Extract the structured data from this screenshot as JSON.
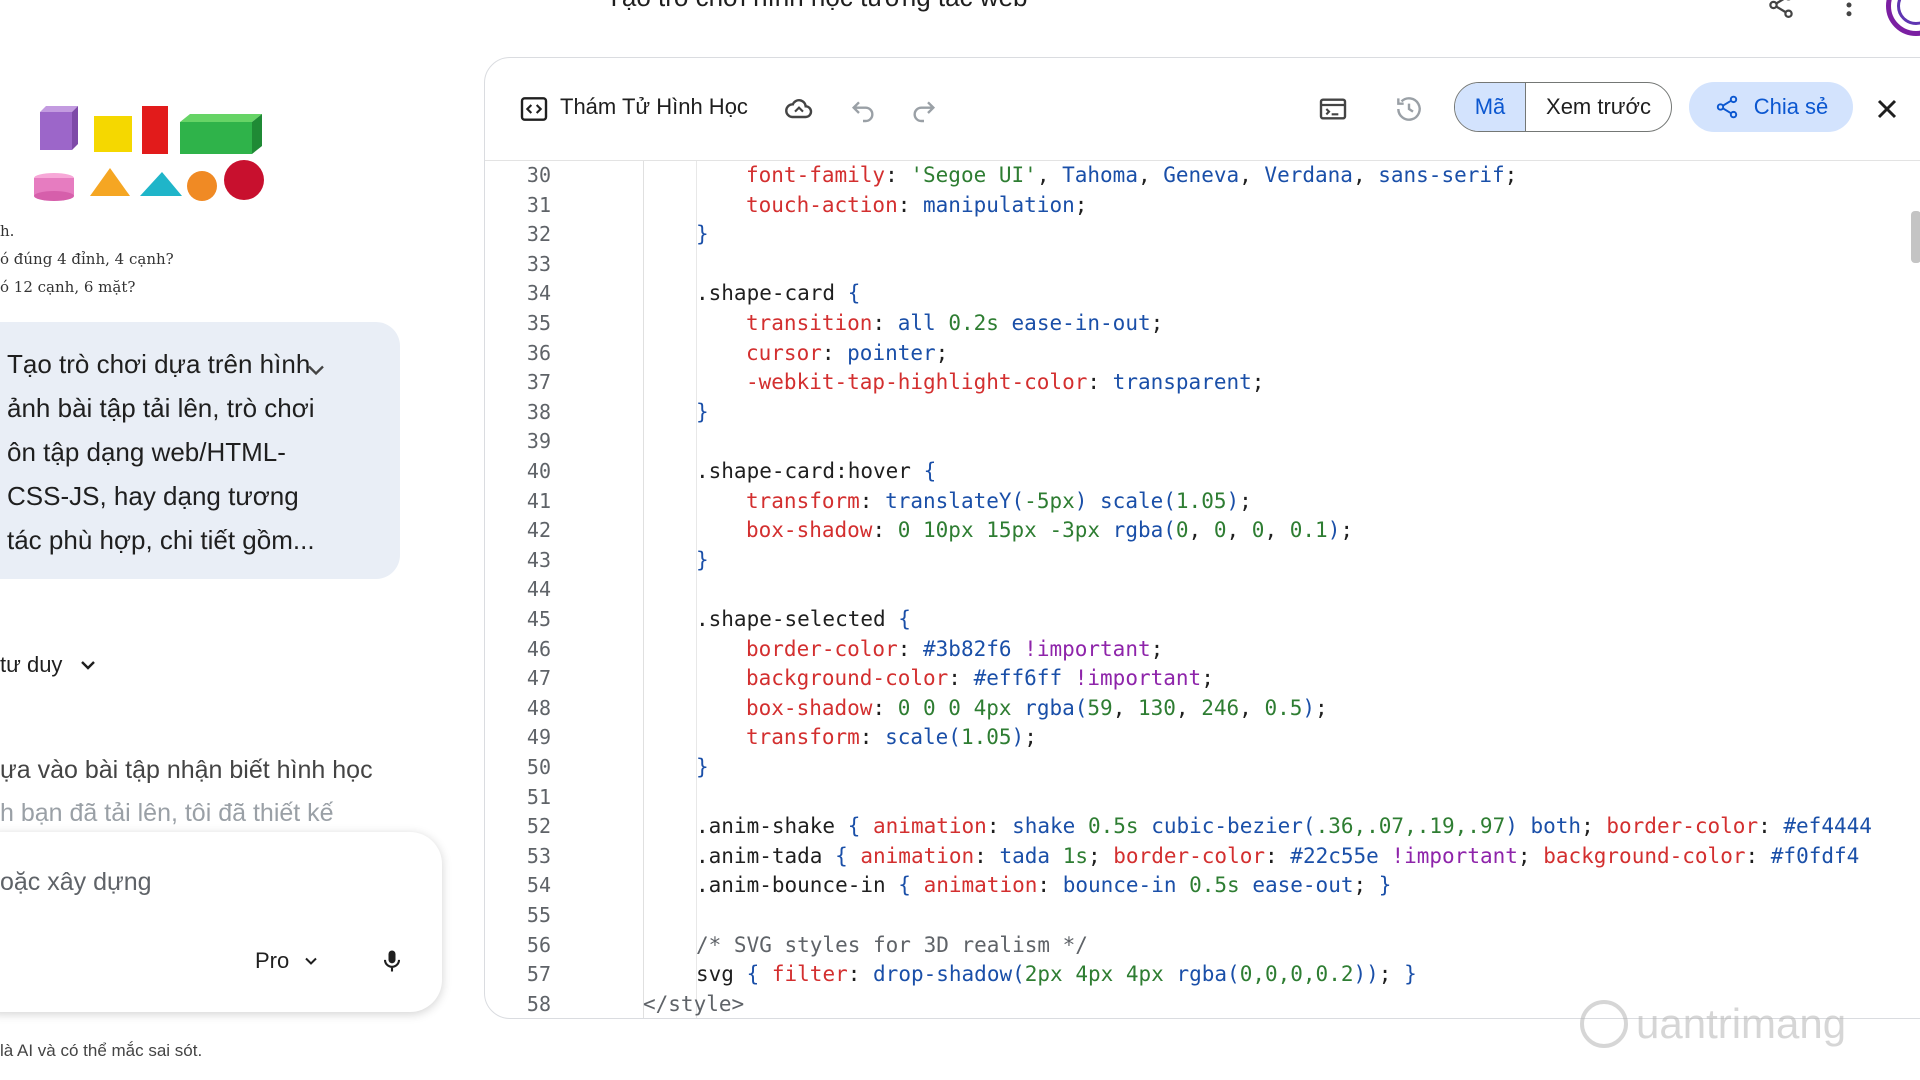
{
  "header": {
    "title": "Tạo trò chơi hình học tương tác web"
  },
  "left": {
    "fragments": [
      "h.",
      "ó đúng 4 đỉnh, 4 cạnh?",
      "ó 12 cạnh, 6 mặt?"
    ],
    "prompt": "Tạo trò chơi dựa trên hình ảnh bài tập tải lên, trò chơi ôn tập dạng web/HTML-CSS-JS, hay dạng tương tác phù hợp, chi tiết gồm...",
    "thinking_label": "tư duy",
    "response_line1": "ựa vào bài tập nhận biết hình học",
    "response_line2": "h bạn đã tải lên, tôi đã thiết kế",
    "input_placeholder": "oặc xây dựng",
    "model_label": "Pro",
    "disclaimer": "là AI và có thể mắc sai sót."
  },
  "canvas": {
    "doc_title": "Thám Tử Hình Học",
    "code_tab": "Mã",
    "preview_tab": "Xem trước",
    "share_label": "Chia sẻ",
    "code_lines": [
      {
        "n": "30",
        "indent": 2,
        "t": [
          [
            "font-family",
            "prop"
          ],
          [
            ": ",
            "punc"
          ],
          [
            "'Segoe UI'",
            "str"
          ],
          [
            ", ",
            "punc"
          ],
          [
            "Tahoma",
            "val"
          ],
          [
            ", ",
            "punc"
          ],
          [
            "Geneva",
            "val"
          ],
          [
            ", ",
            "punc"
          ],
          [
            "Verdana",
            "val"
          ],
          [
            ", ",
            "punc"
          ],
          [
            "sans-serif",
            "val"
          ],
          [
            ";",
            "punc"
          ]
        ]
      },
      {
        "n": "31",
        "indent": 2,
        "t": [
          [
            "touch-action",
            "prop"
          ],
          [
            ": ",
            "punc"
          ],
          [
            "manipulation",
            "val"
          ],
          [
            ";",
            "punc"
          ]
        ]
      },
      {
        "n": "32",
        "indent": 1,
        "t": [
          [
            "}",
            "val"
          ]
        ]
      },
      {
        "n": "33",
        "indent": 0,
        "t": []
      },
      {
        "n": "34",
        "indent": 1,
        "t": [
          [
            ".shape-card ",
            "sel"
          ],
          [
            "{",
            "val"
          ]
        ]
      },
      {
        "n": "35",
        "indent": 2,
        "t": [
          [
            "transition",
            "prop"
          ],
          [
            ": ",
            "punc"
          ],
          [
            "all ",
            "val"
          ],
          [
            "0.2s",
            "num"
          ],
          [
            " ease-in-out",
            "val"
          ],
          [
            ";",
            "punc"
          ]
        ]
      },
      {
        "n": "36",
        "indent": 2,
        "t": [
          [
            "cursor",
            "prop"
          ],
          [
            ": ",
            "punc"
          ],
          [
            "pointer",
            "val"
          ],
          [
            ";",
            "punc"
          ]
        ]
      },
      {
        "n": "37",
        "indent": 2,
        "t": [
          [
            "-webkit-tap-highlight-color",
            "prop"
          ],
          [
            ": ",
            "punc"
          ],
          [
            "transparent",
            "val"
          ],
          [
            ";",
            "punc"
          ]
        ]
      },
      {
        "n": "38",
        "indent": 1,
        "t": [
          [
            "}",
            "val"
          ]
        ]
      },
      {
        "n": "39",
        "indent": 0,
        "t": []
      },
      {
        "n": "40",
        "indent": 1,
        "t": [
          [
            ".shape-card:hover ",
            "sel"
          ],
          [
            "{",
            "val"
          ]
        ]
      },
      {
        "n": "41",
        "indent": 2,
        "t": [
          [
            "transform",
            "prop"
          ],
          [
            ": ",
            "punc"
          ],
          [
            "translateY(",
            "val"
          ],
          [
            "-5px",
            "num"
          ],
          [
            ") scale(",
            "val"
          ],
          [
            "1.05",
            "num"
          ],
          [
            ")",
            "val"
          ],
          [
            ";",
            "punc"
          ]
        ]
      },
      {
        "n": "42",
        "indent": 2,
        "t": [
          [
            "box-shadow",
            "prop"
          ],
          [
            ": ",
            "punc"
          ],
          [
            "0 10px 15px -3px",
            "num"
          ],
          [
            " rgba(",
            "val"
          ],
          [
            "0",
            "num"
          ],
          [
            ", ",
            "punc"
          ],
          [
            "0",
            "num"
          ],
          [
            ", ",
            "punc"
          ],
          [
            "0",
            "num"
          ],
          [
            ", ",
            "punc"
          ],
          [
            "0.1",
            "num"
          ],
          [
            ")",
            "val"
          ],
          [
            ";",
            "punc"
          ]
        ]
      },
      {
        "n": "43",
        "indent": 1,
        "t": [
          [
            "}",
            "val"
          ]
        ]
      },
      {
        "n": "44",
        "indent": 0,
        "t": []
      },
      {
        "n": "45",
        "indent": 1,
        "t": [
          [
            ".shape-selected ",
            "sel"
          ],
          [
            "{",
            "val"
          ]
        ]
      },
      {
        "n": "46",
        "indent": 2,
        "t": [
          [
            "border-color",
            "prop"
          ],
          [
            ": ",
            "punc"
          ],
          [
            "#3b82f6",
            "val"
          ],
          [
            " !important",
            "kw"
          ],
          [
            ";",
            "punc"
          ]
        ]
      },
      {
        "n": "47",
        "indent": 2,
        "t": [
          [
            "background-color",
            "prop"
          ],
          [
            ": ",
            "punc"
          ],
          [
            "#eff6ff",
            "val"
          ],
          [
            " !important",
            "kw"
          ],
          [
            ";",
            "punc"
          ]
        ]
      },
      {
        "n": "48",
        "indent": 2,
        "t": [
          [
            "box-shadow",
            "prop"
          ],
          [
            ": ",
            "punc"
          ],
          [
            "0 0 0 4px",
            "num"
          ],
          [
            " rgba(",
            "val"
          ],
          [
            "59",
            "num"
          ],
          [
            ", ",
            "punc"
          ],
          [
            "130",
            "num"
          ],
          [
            ", ",
            "punc"
          ],
          [
            "246",
            "num"
          ],
          [
            ", ",
            "punc"
          ],
          [
            "0.5",
            "num"
          ],
          [
            ")",
            "val"
          ],
          [
            ";",
            "punc"
          ]
        ]
      },
      {
        "n": "49",
        "indent": 2,
        "t": [
          [
            "transform",
            "prop"
          ],
          [
            ": ",
            "punc"
          ],
          [
            "scale(",
            "val"
          ],
          [
            "1.05",
            "num"
          ],
          [
            ")",
            "val"
          ],
          [
            ";",
            "punc"
          ]
        ]
      },
      {
        "n": "50",
        "indent": 1,
        "t": [
          [
            "}",
            "val"
          ]
        ]
      },
      {
        "n": "51",
        "indent": 0,
        "t": []
      },
      {
        "n": "52",
        "indent": 1,
        "t": [
          [
            ".anim-shake ",
            "sel"
          ],
          [
            "{ ",
            "val"
          ],
          [
            "animation",
            "prop"
          ],
          [
            ": ",
            "punc"
          ],
          [
            "shake ",
            "val"
          ],
          [
            "0.5s",
            "num"
          ],
          [
            " cubic-bezier(",
            "val"
          ],
          [
            ".36,.07,.19,.97",
            "num"
          ],
          [
            ") both",
            "val"
          ],
          [
            "; ",
            "punc"
          ],
          [
            "border-color",
            "prop"
          ],
          [
            ": ",
            "punc"
          ],
          [
            "#ef4444",
            "val"
          ]
        ]
      },
      {
        "n": "53",
        "indent": 1,
        "t": [
          [
            ".anim-tada ",
            "sel"
          ],
          [
            "{ ",
            "val"
          ],
          [
            "animation",
            "prop"
          ],
          [
            ": ",
            "punc"
          ],
          [
            "tada ",
            "val"
          ],
          [
            "1s",
            "num"
          ],
          [
            "; ",
            "punc"
          ],
          [
            "border-color",
            "prop"
          ],
          [
            ": ",
            "punc"
          ],
          [
            "#22c55e",
            "val"
          ],
          [
            " !important",
            "kw"
          ],
          [
            "; ",
            "punc"
          ],
          [
            "background-color",
            "prop"
          ],
          [
            ": ",
            "punc"
          ],
          [
            "#f0fdf4",
            "val"
          ]
        ]
      },
      {
        "n": "54",
        "indent": 1,
        "t": [
          [
            ".anim-bounce-in ",
            "sel"
          ],
          [
            "{ ",
            "val"
          ],
          [
            "animation",
            "prop"
          ],
          [
            ": ",
            "punc"
          ],
          [
            "bounce-in ",
            "val"
          ],
          [
            "0.5s",
            "num"
          ],
          [
            " ease-out",
            "val"
          ],
          [
            "; ",
            "punc"
          ],
          [
            "}",
            "val"
          ]
        ]
      },
      {
        "n": "55",
        "indent": 0,
        "t": []
      },
      {
        "n": "56",
        "indent": 1,
        "t": [
          [
            "/* SVG styles for 3D realism */",
            "com"
          ]
        ]
      },
      {
        "n": "57",
        "indent": 1,
        "t": [
          [
            "svg ",
            "sel"
          ],
          [
            "{ ",
            "val"
          ],
          [
            "filter",
            "prop"
          ],
          [
            ": ",
            "punc"
          ],
          [
            "drop-shadow(",
            "val"
          ],
          [
            "2px 4px 4px",
            "num"
          ],
          [
            " rgba(",
            "val"
          ],
          [
            "0,0,0,0.2",
            "num"
          ],
          [
            "))",
            "val"
          ],
          [
            "; ",
            "punc"
          ],
          [
            "}",
            "val"
          ]
        ]
      },
      {
        "n": "58",
        "indent": 0,
        "t": [
          [
            "</style>",
            "tag"
          ]
        ]
      }
    ]
  },
  "watermark": {
    "text": "uantrimang"
  },
  "colors": {
    "accent": "#0b57d0",
    "accent_bg": "#d3e3fd",
    "bubble_bg": "#e9eef6"
  },
  "icons": [
    "share-icon",
    "more-vert-icon",
    "avatar",
    "code-doc-icon",
    "cloud-icon",
    "undo-icon",
    "redo-icon",
    "console-icon",
    "history-icon",
    "share-nodes-icon",
    "close-icon",
    "chevron-down-icon",
    "mic-icon"
  ]
}
